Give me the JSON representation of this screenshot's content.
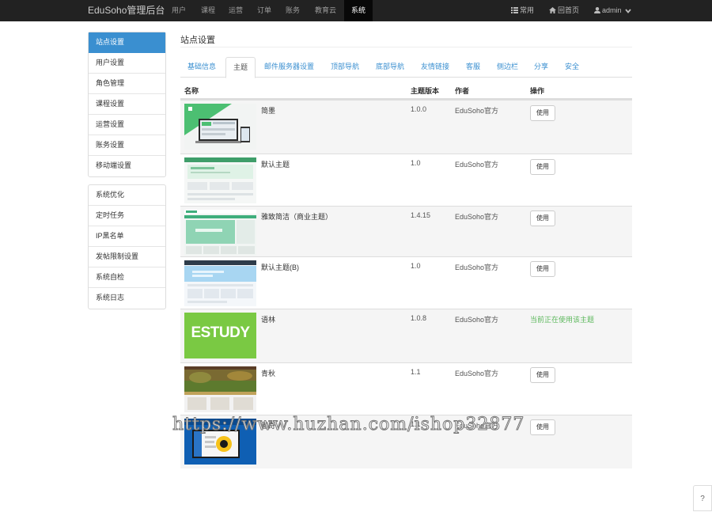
{
  "navbar": {
    "brand": "EduSoho管理后台",
    "items": [
      "用户",
      "课程",
      "运营",
      "订单",
      "账务",
      "教育云",
      "系统"
    ],
    "right": {
      "common": "常用",
      "home": "回首页",
      "user": "admin"
    }
  },
  "sidebar": {
    "group1": [
      "站点设置",
      "用户设置",
      "角色管理",
      "课程设置",
      "运营设置",
      "账务设置",
      "移动端设置"
    ],
    "group2": [
      "系统优化",
      "定时任务",
      "IP黑名单",
      "发帖限制设置",
      "系统自检",
      "系统日志"
    ]
  },
  "page": {
    "title": "站点设置"
  },
  "tabs": [
    "基础信息",
    "主题",
    "邮件服务器设置",
    "顶部导航",
    "底部导航",
    "友情链接",
    "客服",
    "侧边栏",
    "分享",
    "安全"
  ],
  "table": {
    "headers": {
      "name": "名称",
      "version": "主题版本",
      "author": "作者",
      "action": "操作"
    },
    "use_label": "使用",
    "current_label": "当前正在使用该主题",
    "rows": [
      {
        "name": "简墨",
        "version": "1.0.0",
        "author": "EduSoho官方"
      },
      {
        "name": "默认主题",
        "version": "1.0",
        "author": "EduSoho官方"
      },
      {
        "name": "雅致简洁（商业主题）",
        "version": "1.4.15",
        "author": "EduSoho官方"
      },
      {
        "name": "默认主题(B)",
        "version": "1.0",
        "author": "EduSoho官方"
      },
      {
        "name": "语林",
        "version": "1.0.8",
        "author": "EduSoho官方",
        "thumb_text": "ESTUDY"
      },
      {
        "name": "青秋",
        "version": "1.1",
        "author": "EduSoho官方"
      },
      {
        "name": "图奇",
        "version": "1.1",
        "author": "EduSoho官方"
      }
    ]
  },
  "watermark": "https://www.huzhan.com/ishop32877",
  "help_icon": "?"
}
